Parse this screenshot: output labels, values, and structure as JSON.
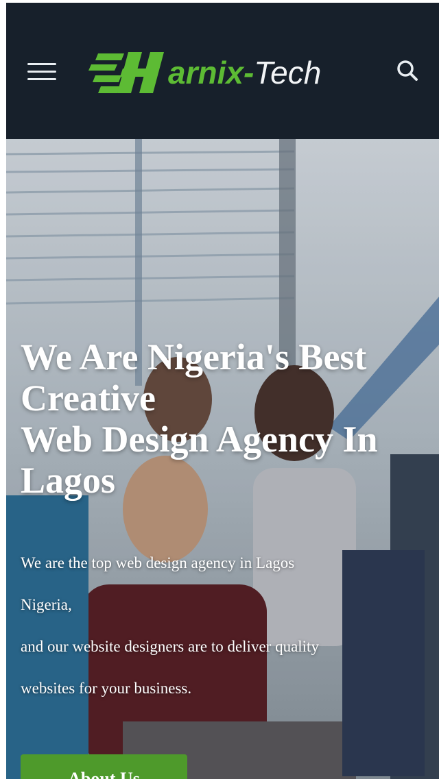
{
  "header": {
    "logo": {
      "part1": "arnix-",
      "part2": "Tech",
      "letter": "H"
    },
    "colors": {
      "background": "#17202b",
      "brand_green": "#5dbb34"
    },
    "icons": {
      "menu": "hamburger-menu-icon",
      "search": "search-icon"
    }
  },
  "hero": {
    "title_lines": [
      "We Are Nigeria's Best",
      "Creative",
      "Web Design Agency In",
      "Lagos"
    ],
    "text_lines": [
      "We are the top web design agency in Lagos",
      "Nigeria,",
      "and our website designers are to deliver quality",
      "websites for your business."
    ],
    "cta_label": "About Us"
  }
}
